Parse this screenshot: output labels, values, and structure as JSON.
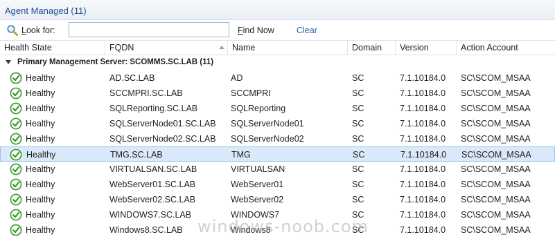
{
  "title": "Agent Managed (11)",
  "search": {
    "look_for_label_prefix": "",
    "look_for_accel": "L",
    "look_for_label_rest": "ook for:",
    "input_value": "",
    "find_now_accel": "F",
    "find_now_rest": "ind Now",
    "clear_label": "Clear"
  },
  "columns": [
    "Health State",
    "FQDN",
    "Name",
    "Domain",
    "Version",
    "Action Account"
  ],
  "sorted_column": "FQDN",
  "group": {
    "label": "Primary Management Server: SCOMMS.SC.LAB (11)"
  },
  "rows": [
    {
      "health": "Healthy",
      "fqdn": "AD.SC.LAB",
      "name": "AD",
      "domain": "SC",
      "version": "7.1.10184.0",
      "account": "SC\\SCOM_MSAA"
    },
    {
      "health": "Healthy",
      "fqdn": "SCCMPRI.SC.LAB",
      "name": "SCCMPRI",
      "domain": "SC",
      "version": "7.1.10184.0",
      "account": "SC\\SCOM_MSAA"
    },
    {
      "health": "Healthy",
      "fqdn": "SQLReporting.SC.LAB",
      "name": "SQLReporting",
      "domain": "SC",
      "version": "7.1.10184.0",
      "account": "SC\\SCOM_MSAA"
    },
    {
      "health": "Healthy",
      "fqdn": "SQLServerNode01.SC.LAB",
      "name": "SQLServerNode01",
      "domain": "SC",
      "version": "7.1.10184.0",
      "account": "SC\\SCOM_MSAA"
    },
    {
      "health": "Healthy",
      "fqdn": "SQLServerNode02.SC.LAB",
      "name": "SQLServerNode02",
      "domain": "SC",
      "version": "7.1.10184.0",
      "account": "SC\\SCOM_MSAA"
    },
    {
      "health": "Healthy",
      "fqdn": "TMG.SC.LAB",
      "name": "TMG",
      "domain": "SC",
      "version": "7.1.10184.0",
      "account": "SC\\SCOM_MSAA"
    },
    {
      "health": "Healthy",
      "fqdn": "VIRTUALSAN.SC.LAB",
      "name": "VIRTUALSAN",
      "domain": "SC",
      "version": "7.1.10184.0",
      "account": "SC\\SCOM_MSAA"
    },
    {
      "health": "Healthy",
      "fqdn": "WebServer01.SC.LAB",
      "name": "WebServer01",
      "domain": "SC",
      "version": "7.1.10184.0",
      "account": "SC\\SCOM_MSAA"
    },
    {
      "health": "Healthy",
      "fqdn": "WebServer02.SC.LAB",
      "name": "WebServer02",
      "domain": "SC",
      "version": "7.1.10184.0",
      "account": "SC\\SCOM_MSAA"
    },
    {
      "health": "Healthy",
      "fqdn": "WINDOWS7.SC.LAB",
      "name": "WINDOWS7",
      "domain": "SC",
      "version": "7.1.10184.0",
      "account": "SC\\SCOM_MSAA"
    },
    {
      "health": "Healthy",
      "fqdn": "Windows8.SC.LAB",
      "name": "Windows8",
      "domain": "SC",
      "version": "7.1.10184.0",
      "account": "SC\\SCOM_MSAA"
    }
  ],
  "selected_row": 5,
  "watermark": "windows-noob.com",
  "colors": {
    "title": "#1f4e8c",
    "link": "#1f5faa",
    "selected_bg": "#d9e9f9",
    "healthy_green": "#3a9a2a"
  },
  "icons": {
    "search": "magnifier-icon",
    "health": "healthy-check-icon"
  }
}
